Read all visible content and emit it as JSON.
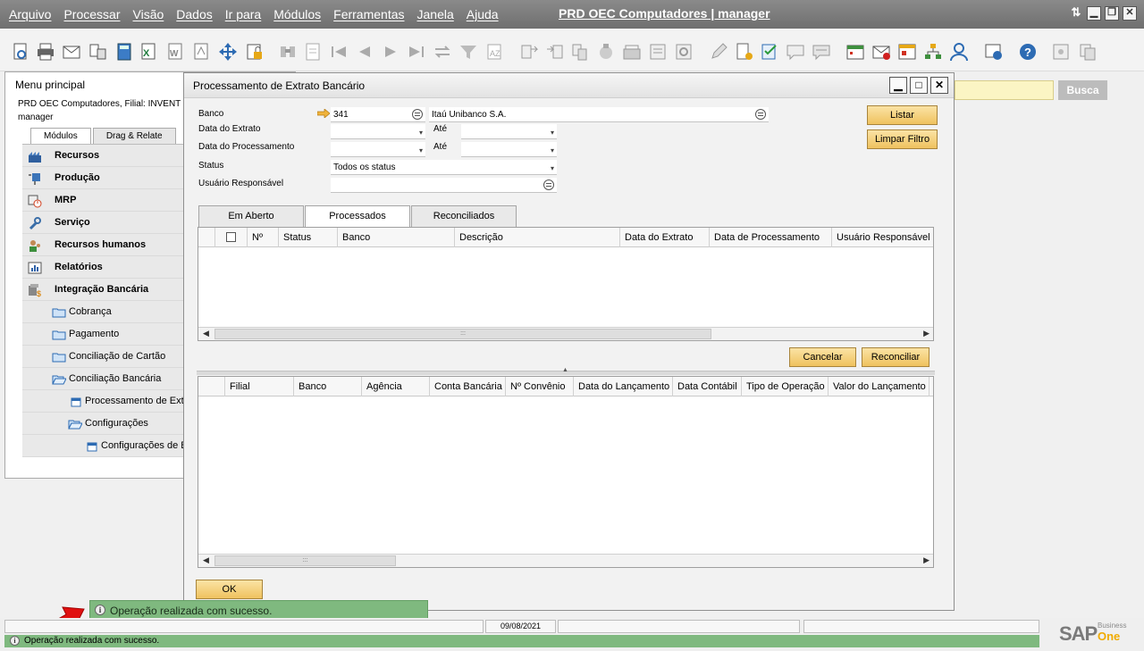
{
  "menubar": {
    "items": [
      "Arquivo",
      "Processar",
      "Visão",
      "Dados",
      "Ir para",
      "Módulos",
      "Ferramentas",
      "Janela",
      "Ajuda"
    ],
    "title": "PRD OEC Computadores | manager"
  },
  "toolbar": {
    "icons": [
      "preview-icon",
      "print-icon",
      "email-icon",
      "export-icon",
      "calculator-icon",
      "excel-icon",
      "word-icon",
      "pdf-icon",
      "move-icon",
      "lock-icon",
      "find-icon",
      "add-icon",
      "first-record-icon",
      "previous-record-icon",
      "next-record-icon",
      "last-record-icon",
      "refresh-icon",
      "filter-icon",
      "sort-icon",
      "base-document-icon",
      "target-document-icon",
      "doc-group-icon",
      "gross-profit-icon",
      "volume-weight-icon",
      "transaction-journal-icon",
      "settings-icon",
      "edit-icon",
      "new-doc-icon",
      "checklist-icon",
      "message-icon",
      "message-reply-icon",
      "calendar-icon",
      "inbox-icon",
      "report-icon",
      "org-chart-icon",
      "user-icon",
      "browser-icon",
      "help-icon",
      "config-icon",
      "copy-icon"
    ]
  },
  "search": {
    "button_label": "Busca"
  },
  "main_menu": {
    "title": "Menu principal",
    "company": "PRD OEC Computadores, Filial: INVENT",
    "user": "manager",
    "tabs": [
      "Módulos",
      "Drag & Relate"
    ],
    "modules": [
      "Recursos",
      "Produção",
      "MRP",
      "Serviço",
      "Recursos humanos",
      "Relatórios",
      "Integração Bancária"
    ],
    "submenu": [
      "Cobrança",
      "Pagamento",
      "Conciliação de Cartão",
      "Conciliação Bancária",
      "Processamento de Extrato Bancário",
      "Configurações",
      "Configurações de Banco"
    ]
  },
  "dialog": {
    "title": "Processamento de Extrato Bancário",
    "labels": {
      "banco": "Banco",
      "data_extrato": "Data do Extrato",
      "data_processamento": "Data do Processamento",
      "status": "Status",
      "usuario": "Usuário Responsável",
      "ate": "Até"
    },
    "values": {
      "banco_code": "341",
      "banco_name": "Itaú Unibanco  S.A.",
      "status": "Todos os status"
    },
    "buttons": {
      "listar": "Listar",
      "limpar": "Limpar Filtro",
      "cancelar": "Cancelar",
      "reconciliar": "Reconciliar",
      "ok": "OK"
    },
    "tabs": [
      "Em Aberto",
      "Processados",
      "Reconciliados"
    ],
    "active_tab": "Processados",
    "grid1_columns": [
      "Nº",
      "Status",
      "Banco",
      "Descrição",
      "Data do Extrato",
      "Data de Processamento",
      "Usuário Responsável"
    ],
    "grid2_columns": [
      "Filial",
      "Banco",
      "Agência",
      "Conta Bancária",
      "Nº Convênio",
      "Data do Lançamento",
      "Data Contábil",
      "Tipo de Operação",
      "Valor do Lançamento"
    ]
  },
  "status": {
    "message": "Operação realizada com sucesso.",
    "date": "09/08/2021",
    "logo_text": "SAP",
    "logo_sub1": "Business",
    "logo_sub2": "One",
    "success_color": "#7fb97f"
  }
}
